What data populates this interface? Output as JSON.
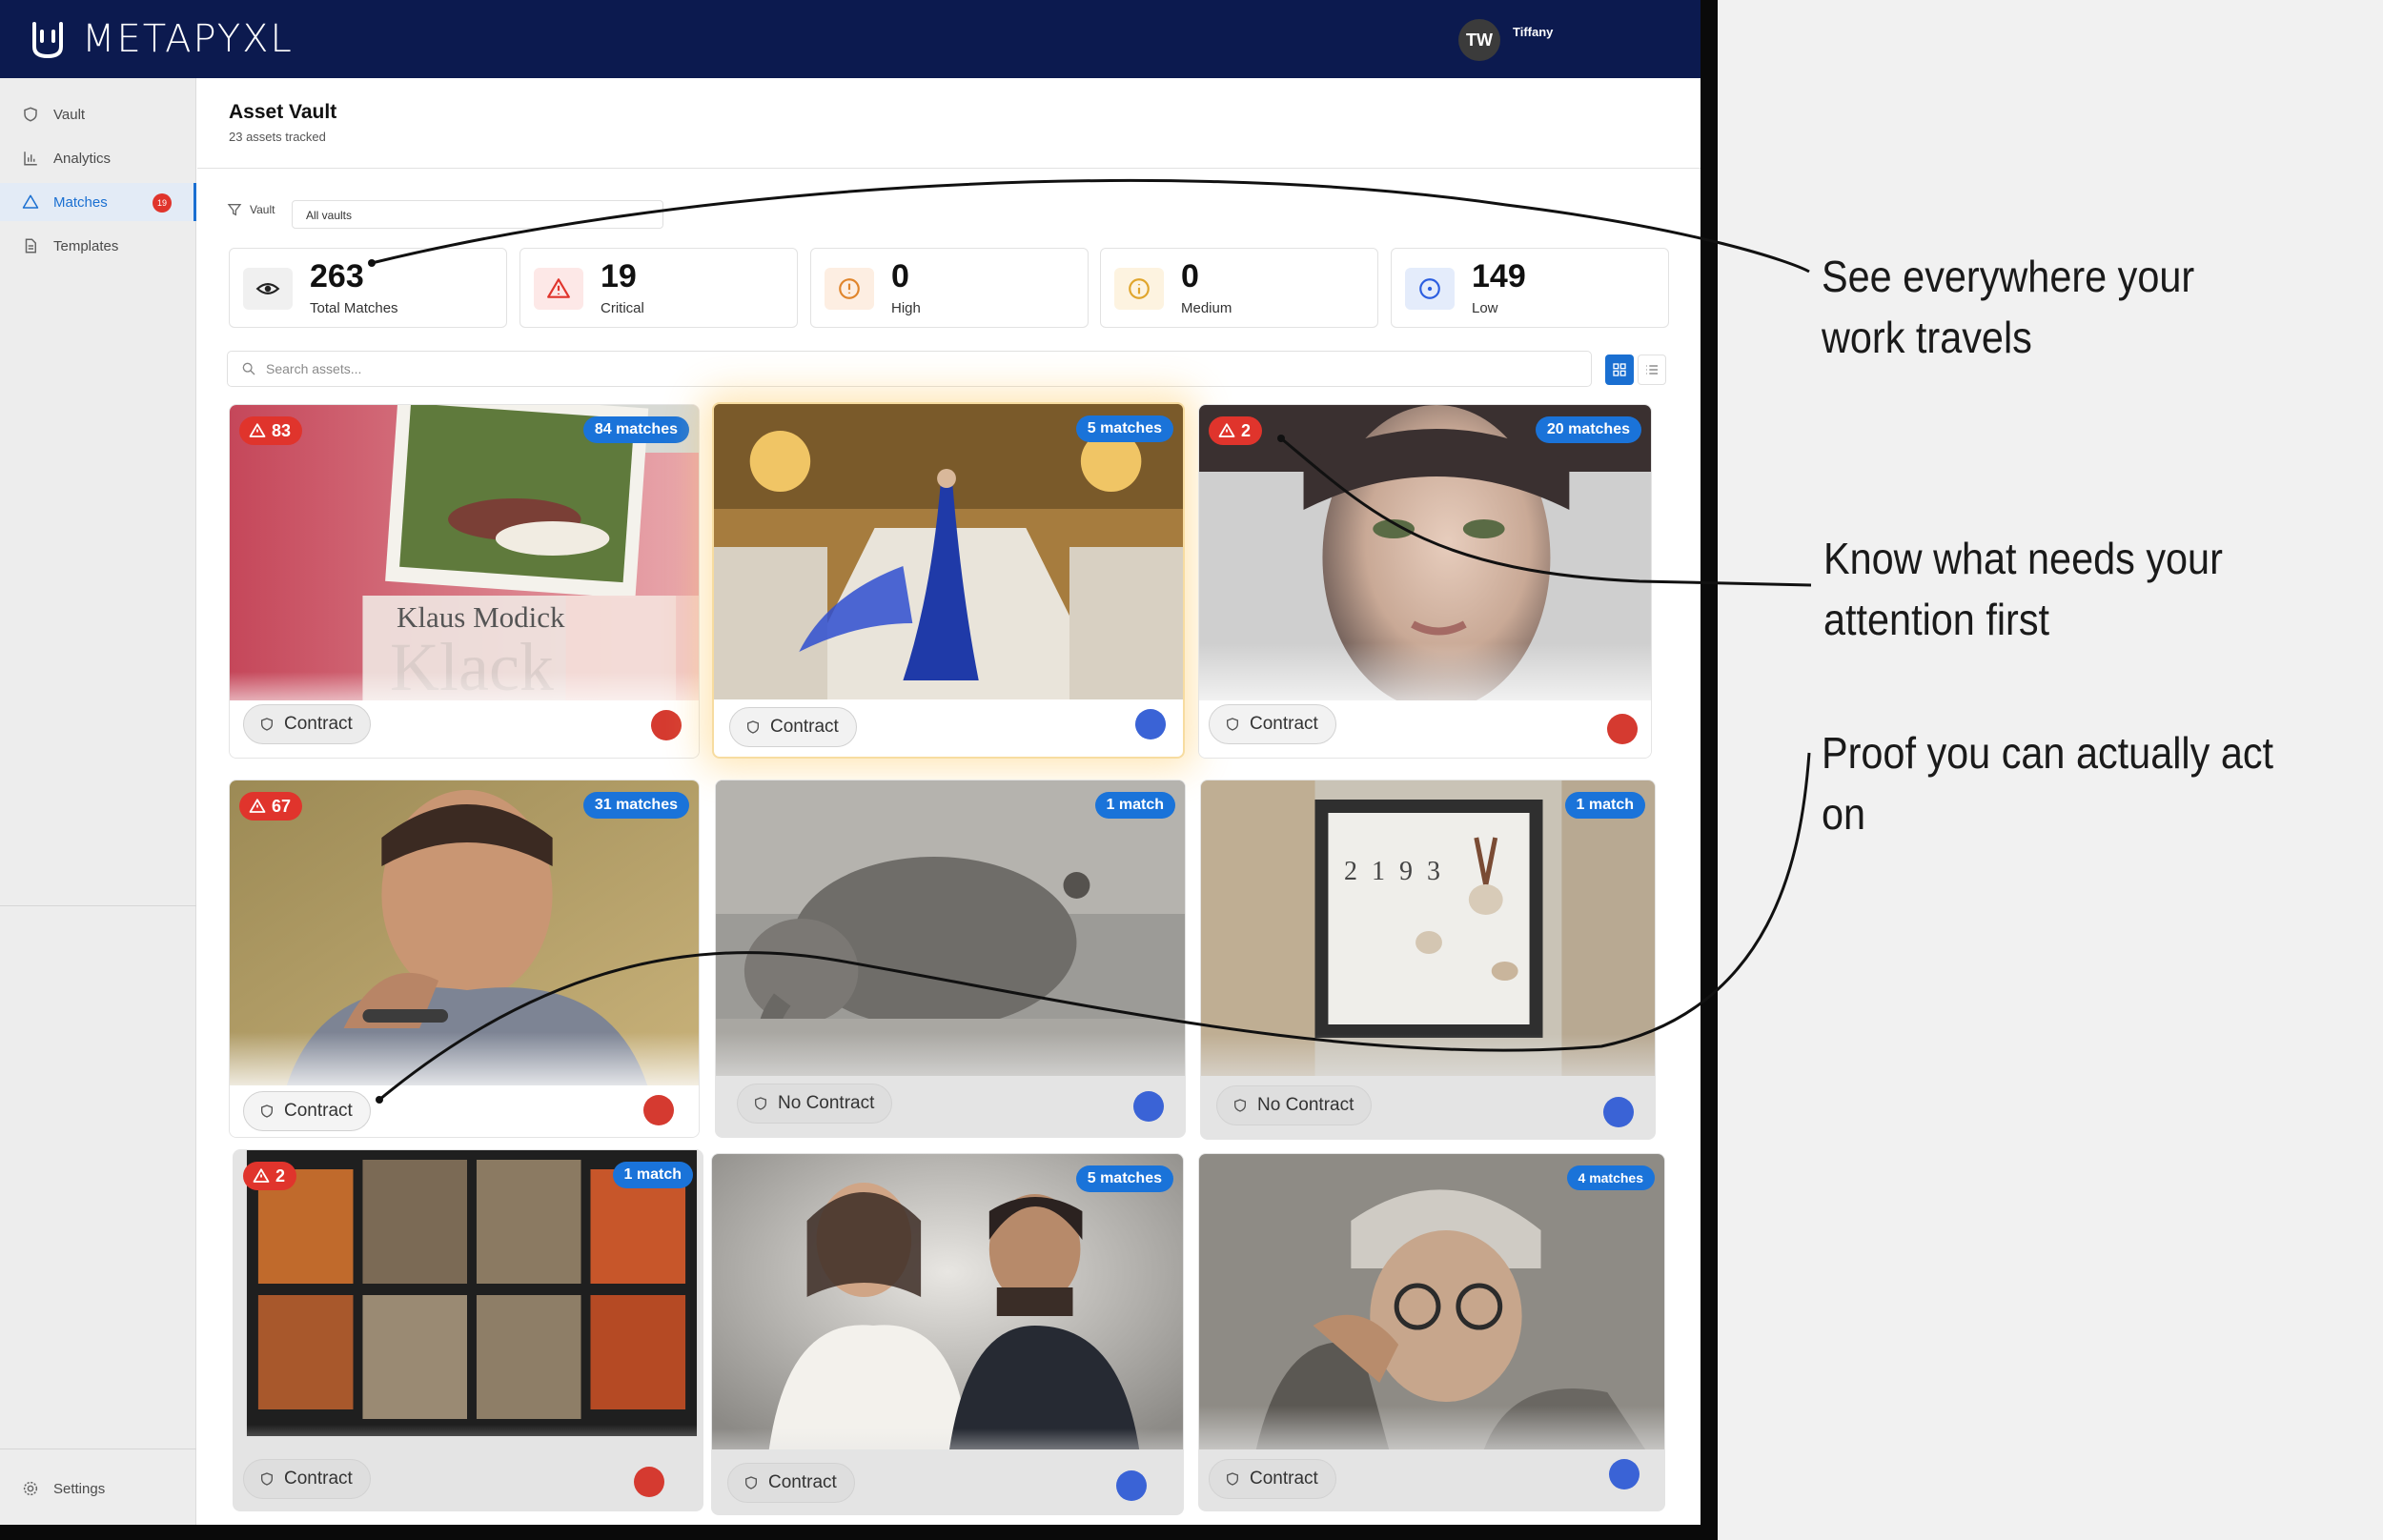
{
  "app": {
    "logo_text": "METAPYXL",
    "user_initials": "TW",
    "user_name": "Tiffany"
  },
  "sidebar": {
    "items": [
      {
        "label": "Vault",
        "icon": "shield-icon"
      },
      {
        "label": "Analytics",
        "icon": "bar-chart-icon"
      },
      {
        "label": "Matches",
        "icon": "alert-triangle-icon",
        "active": true,
        "badge": "19"
      },
      {
        "label": "Templates",
        "icon": "document-icon"
      }
    ],
    "settings_label": "Settings"
  },
  "header": {
    "title": "Asset Vault",
    "subtitle": "23 assets tracked"
  },
  "filter": {
    "label": "Vault",
    "selected": "All vaults"
  },
  "stats": [
    {
      "value": "263",
      "label": "Total Matches",
      "icon": "eye-icon",
      "color": "#333333"
    },
    {
      "value": "19",
      "label": "Critical",
      "icon": "alert-triangle-icon",
      "color": "#e0342c"
    },
    {
      "value": "0",
      "label": "High",
      "icon": "alert-circle-icon",
      "color": "#e0852c"
    },
    {
      "value": "0",
      "label": "Medium",
      "icon": "info-icon",
      "color": "#e0a52c"
    },
    {
      "value": "149",
      "label": "Low",
      "icon": "target-icon",
      "color": "#2c5ee0"
    }
  ],
  "search": {
    "placeholder": "Search assets..."
  },
  "cards": [
    {
      "matches": "84 matches",
      "alert": "83",
      "contract": "Contract",
      "status": "red",
      "book_author": "Klaus Modick",
      "book_title": "Klack"
    },
    {
      "matches": "5 matches",
      "contract": "Contract",
      "status": "blue"
    },
    {
      "matches": "20 matches",
      "alert": "2",
      "contract": "Contract",
      "status": "red"
    },
    {
      "matches": "31 matches",
      "alert": "67",
      "contract": "Contract",
      "status": "red"
    },
    {
      "matches": "1 match",
      "contract": "No Contract",
      "status": "blue"
    },
    {
      "matches": "1 match",
      "contract": "No Contract",
      "status": "blue",
      "art_text": "2 1 9 3"
    },
    {
      "matches": "1 match",
      "alert": "2",
      "contract": "Contract",
      "status": "red"
    },
    {
      "matches": "5 matches",
      "contract": "Contract",
      "status": "blue"
    },
    {
      "matches": "4 matches",
      "contract": "Contract",
      "status": "blue"
    }
  ],
  "callouts": [
    "See everywhere your\nwork travels",
    "Know what needs your\nattention first",
    "Proof you can actually act on"
  ],
  "colors": {
    "topbar": "#0c1a4f",
    "accent": "#1a73d9",
    "critical": "#e0342c",
    "low": "#3a63d6"
  }
}
